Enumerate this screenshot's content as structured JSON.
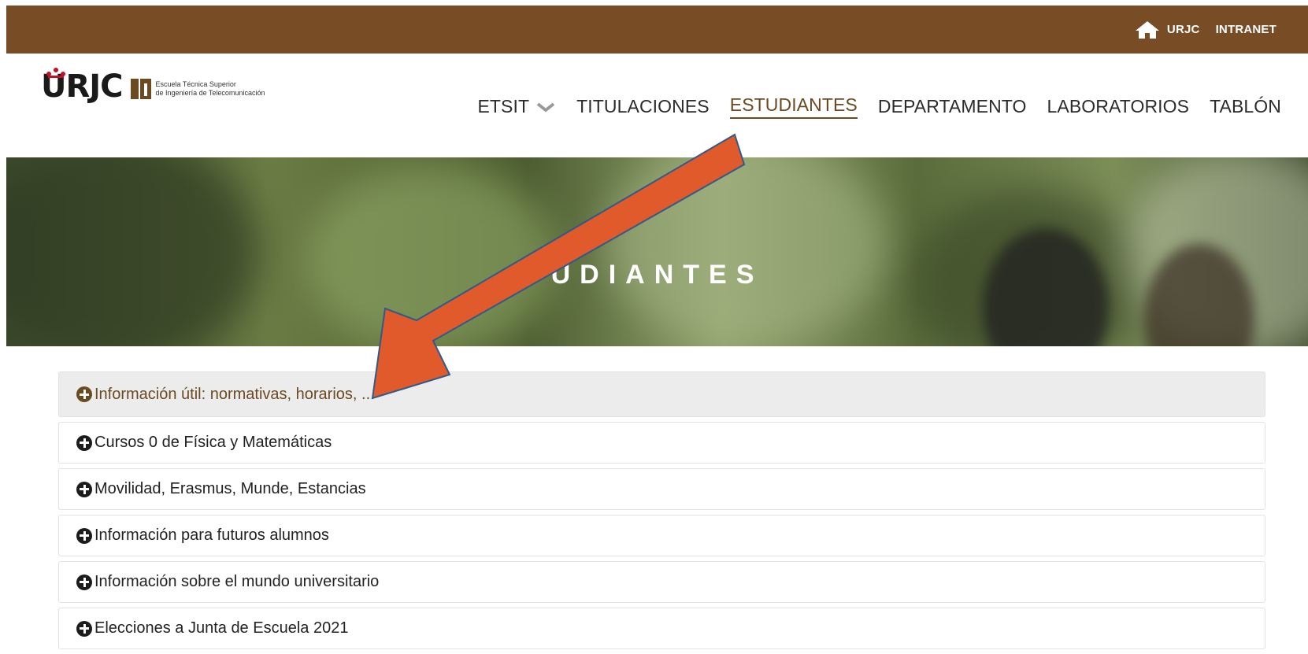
{
  "topbar": {
    "links": [
      "URJC",
      "INTRANET"
    ],
    "bg_color": "#784d25"
  },
  "logo": {
    "wordmark": "URJC",
    "school_line1": "Escuela Técnica Superior",
    "school_line2": "de Ingeniería de Telecomunicación"
  },
  "nav": {
    "items": [
      "ETSIT",
      "TITULACIONES",
      "ESTUDIANTES",
      "DEPARTAMENTO",
      "LABORATORIOS",
      "TABLÓN"
    ],
    "active": "ESTUDIANTES"
  },
  "hero": {
    "title": "UDIANTES"
  },
  "accordion": {
    "items": [
      "Información útil: normativas, horarios, ...",
      "Cursos 0 de Física y Matemáticas",
      "Movilidad, Erasmus, Munde, Estancias",
      "Información para futuros alumnos",
      "Información sobre el mundo universitario",
      "Elecciones a Junta de Escuela 2021"
    ]
  },
  "annotation": {
    "arrow_color": "#e05a2b",
    "icon": "arrow-annotation-icon"
  }
}
